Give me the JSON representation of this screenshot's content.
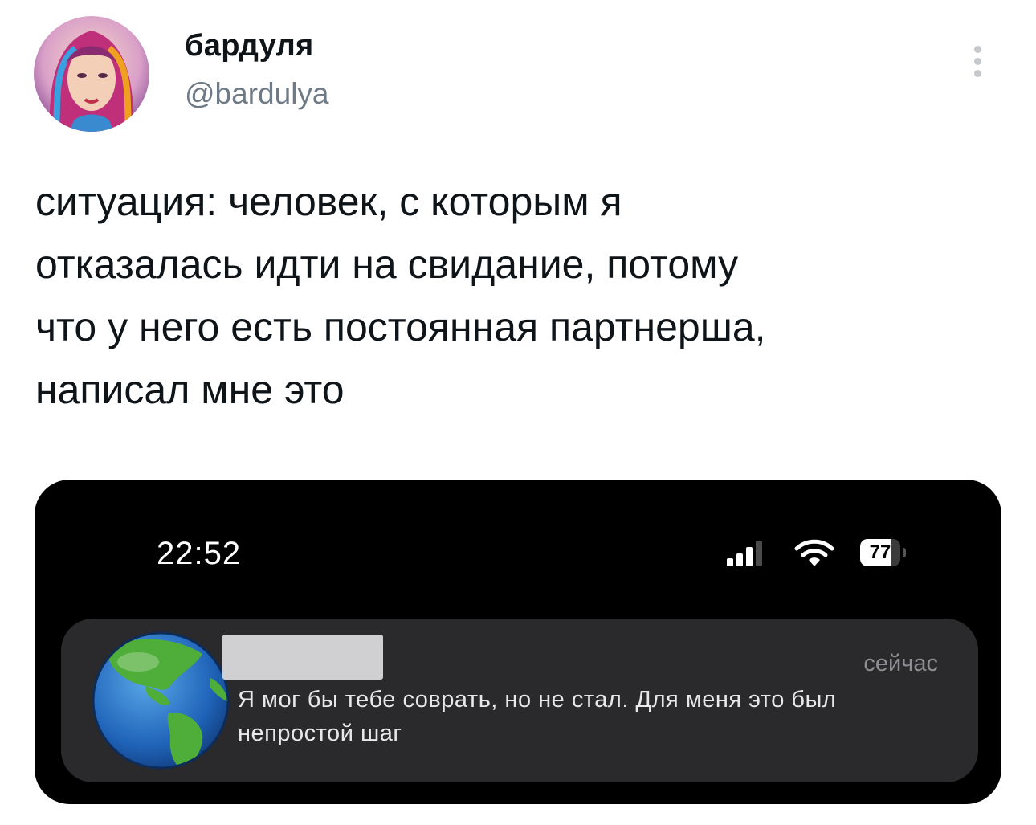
{
  "author": {
    "name": "бардуля",
    "handle": "@bardulya",
    "avatar_icon": "avatar-portrait-icon"
  },
  "tweet": {
    "text": "ситуация: человек, с которым я\nотказалась идти на свидание, потому\nчто у него есть постоянная партнерша,\nнаписал мне это",
    "menu_icon": "more-vertical-icon"
  },
  "screenshot": {
    "status_bar": {
      "time": "22:52",
      "battery_level": "77",
      "battery_fraction": 0.77
    },
    "notification": {
      "time": "сейчас",
      "body": "Я мог бы тебе соврать, но не стал. Для меня это был непростой шаг",
      "app_icon": "globe-icon"
    }
  },
  "colors": {
    "text": "#0f1419",
    "handle": "#6e7a86",
    "screenshot_bg": "#000000",
    "notification_bg": "#2a2a2c"
  }
}
